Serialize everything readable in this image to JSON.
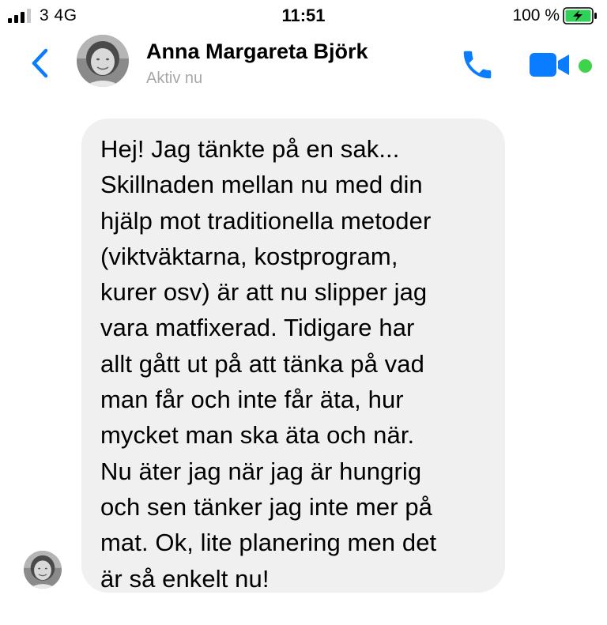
{
  "status_bar": {
    "carrier": "3  4G",
    "time": "11:51",
    "battery": "100 %",
    "icons": [
      "signal-bars-icon",
      "battery-charging-icon"
    ]
  },
  "header": {
    "contact_name": "Anna Margareta Björk",
    "contact_status": "Aktiv nu",
    "icons": [
      "back-chevron-icon",
      "avatar",
      "phone-icon",
      "video-camera-icon",
      "online-dot-icon"
    ]
  },
  "colors": {
    "accent": "#0a7cff",
    "online": "#3dd44b",
    "bubble": "#f1f0f0",
    "status_text": "#a7a7a7",
    "battery_fill": "#30d158"
  },
  "messages": [
    {
      "sender": "Anna Margareta Björk",
      "text": "Hej! Jag tänkte på en sak...\nSkillnaden mellan nu med din\nhjälp mot traditionella metoder\n(viktväktarna, kostprogram,\nkurer osv) är att nu slipper jag\nvara matfixerad. Tidigare har\nallt gått ut på att tänka på vad\nman får och inte får äta, hur\nmycket man ska äta och när.\nNu äter jag när jag är hungrig\noch sen tänker jag inte mer på\nmat. Ok, lite planering men det\när så enkelt nu!"
    }
  ]
}
